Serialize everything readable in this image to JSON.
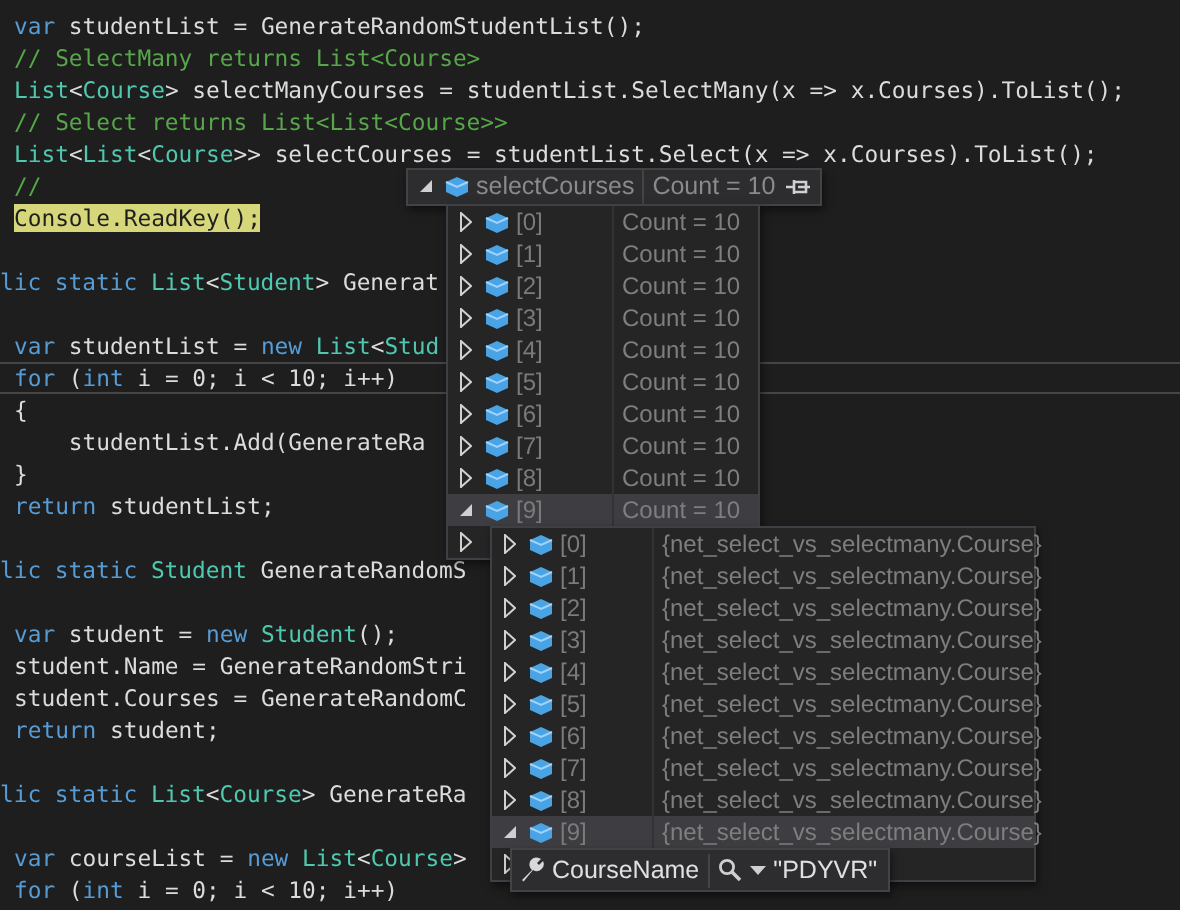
{
  "code": {
    "lines": [
      {
        "kind": "code",
        "current": false,
        "tokens": [
          {
            "text": "var",
            "kind": "keyword"
          },
          {
            "text": " studentList = GenerateRandomStudentList();",
            "kind": "plain"
          }
        ]
      },
      {
        "kind": "code",
        "current": false,
        "tokens": [
          {
            "text": "// SelectMany returns List<Course>",
            "kind": "comment"
          }
        ]
      },
      {
        "kind": "code",
        "current": false,
        "tokens": [
          {
            "text": "List",
            "kind": "type"
          },
          {
            "text": "<",
            "kind": "plain"
          },
          {
            "text": "Course",
            "kind": "type"
          },
          {
            "text": "> selectManyCourses = studentList.SelectMany(x => x.Courses).ToList();",
            "kind": "plain"
          }
        ]
      },
      {
        "kind": "code",
        "current": false,
        "tokens": [
          {
            "text": "// Select returns List<List<Course>>",
            "kind": "comment"
          }
        ]
      },
      {
        "kind": "code",
        "current": false,
        "tokens": [
          {
            "text": "List",
            "kind": "type"
          },
          {
            "text": "<",
            "kind": "plain"
          },
          {
            "text": "List",
            "kind": "type"
          },
          {
            "text": "<",
            "kind": "plain"
          },
          {
            "text": "Course",
            "kind": "type"
          },
          {
            "text": ">> selectCourses = studentList.Select(x => x.Courses).ToList();",
            "kind": "plain"
          }
        ]
      },
      {
        "kind": "code",
        "current": false,
        "tokens": [
          {
            "text": "//",
            "kind": "comment"
          }
        ]
      },
      {
        "kind": "code",
        "current": false,
        "tokens": [
          {
            "text": "Console.ReadKey();",
            "kind": "highlight"
          }
        ]
      },
      {
        "kind": "blank",
        "current": false
      },
      {
        "kind": "cut",
        "current": false,
        "tokens": [
          {
            "text": "lic static ",
            "kind": "keyword"
          },
          {
            "text": "List",
            "kind": "type"
          },
          {
            "text": "<",
            "kind": "plain"
          },
          {
            "text": "Student",
            "kind": "type"
          },
          {
            "text": "> Generat",
            "kind": "plain"
          }
        ]
      },
      {
        "kind": "blank",
        "current": false
      },
      {
        "kind": "code",
        "current": false,
        "tokens": [
          {
            "text": "var",
            "kind": "keyword"
          },
          {
            "text": " studentList = ",
            "kind": "plain"
          },
          {
            "text": "new ",
            "kind": "keyword"
          },
          {
            "text": "List",
            "kind": "type"
          },
          {
            "text": "<",
            "kind": "plain"
          },
          {
            "text": "Stud",
            "kind": "type"
          }
        ]
      },
      {
        "kind": "code",
        "current": true,
        "tokens": [
          {
            "text": "for",
            "kind": "keyword"
          },
          {
            "text": " (",
            "kind": "plain"
          },
          {
            "text": "int",
            "kind": "keyword"
          },
          {
            "text": " i = 0; i < 10; i++)",
            "kind": "plain"
          }
        ]
      },
      {
        "kind": "code",
        "current": false,
        "tokens": [
          {
            "text": "{",
            "kind": "plain"
          }
        ]
      },
      {
        "kind": "code",
        "current": false,
        "tokens": [
          {
            "text": "    studentList.Add(GenerateRa",
            "kind": "plain"
          }
        ]
      },
      {
        "kind": "code",
        "current": false,
        "tokens": [
          {
            "text": "}",
            "kind": "plain"
          }
        ]
      },
      {
        "kind": "code",
        "current": false,
        "tokens": [
          {
            "text": "return",
            "kind": "keyword"
          },
          {
            "text": " studentList;",
            "kind": "plain"
          }
        ]
      },
      {
        "kind": "blank",
        "current": false
      },
      {
        "kind": "cut",
        "current": false,
        "tokens": [
          {
            "text": "lic static ",
            "kind": "keyword"
          },
          {
            "text": "Student",
            "kind": "type"
          },
          {
            "text": " GenerateRandomS",
            "kind": "plain"
          }
        ]
      },
      {
        "kind": "blank",
        "current": false
      },
      {
        "kind": "code",
        "current": false,
        "tokens": [
          {
            "text": "var",
            "kind": "keyword"
          },
          {
            "text": " student = ",
            "kind": "plain"
          },
          {
            "text": "new ",
            "kind": "keyword"
          },
          {
            "text": "Student",
            "kind": "type"
          },
          {
            "text": "();",
            "kind": "plain"
          }
        ]
      },
      {
        "kind": "code",
        "current": false,
        "tokens": [
          {
            "text": "student.Name = GenerateRandomStri",
            "kind": "plain"
          }
        ]
      },
      {
        "kind": "code",
        "current": false,
        "tokens": [
          {
            "text": "student.Courses = GenerateRandomC",
            "kind": "plain"
          }
        ]
      },
      {
        "kind": "code",
        "current": false,
        "tokens": [
          {
            "text": "return",
            "kind": "keyword"
          },
          {
            "text": " student;",
            "kind": "plain"
          }
        ]
      },
      {
        "kind": "blank",
        "current": false
      },
      {
        "kind": "cut",
        "current": false,
        "tokens": [
          {
            "text": "lic static ",
            "kind": "keyword"
          },
          {
            "text": "List",
            "kind": "type"
          },
          {
            "text": "<",
            "kind": "plain"
          },
          {
            "text": "Course",
            "kind": "type"
          },
          {
            "text": "> GenerateRa",
            "kind": "plain"
          }
        ]
      },
      {
        "kind": "blank",
        "current": false
      },
      {
        "kind": "code",
        "current": false,
        "tokens": [
          {
            "text": "var",
            "kind": "keyword"
          },
          {
            "text": " courseList = ",
            "kind": "plain"
          },
          {
            "text": "new ",
            "kind": "keyword"
          },
          {
            "text": "List",
            "kind": "type"
          },
          {
            "text": "<",
            "kind": "plain"
          },
          {
            "text": "Course",
            "kind": "type"
          },
          {
            "text": ">",
            "kind": "plain"
          }
        ]
      },
      {
        "kind": "code",
        "current": false,
        "tokens": [
          {
            "text": "for",
            "kind": "keyword"
          },
          {
            "text": " (",
            "kind": "plain"
          },
          {
            "text": "int",
            "kind": "keyword"
          },
          {
            "text": " i = 0; i < 10; i++)",
            "kind": "plain"
          }
        ]
      }
    ]
  },
  "datatip": {
    "header": {
      "kind": "object",
      "name": "selectCourses",
      "value": "Count = 10",
      "expanded": true
    },
    "rows": [
      {
        "name": "[0]",
        "value": "Count = 10",
        "expanded": false,
        "selected": false
      },
      {
        "name": "[1]",
        "value": "Count = 10",
        "expanded": false,
        "selected": false
      },
      {
        "name": "[2]",
        "value": "Count = 10",
        "expanded": false,
        "selected": false
      },
      {
        "name": "[3]",
        "value": "Count = 10",
        "expanded": false,
        "selected": false
      },
      {
        "name": "[4]",
        "value": "Count = 10",
        "expanded": false,
        "selected": false
      },
      {
        "name": "[5]",
        "value": "Count = 10",
        "expanded": false,
        "selected": false
      },
      {
        "name": "[6]",
        "value": "Count = 10",
        "expanded": false,
        "selected": false
      },
      {
        "name": "[7]",
        "value": "Count = 10",
        "expanded": false,
        "selected": false
      },
      {
        "name": "[8]",
        "value": "Count = 10",
        "expanded": false,
        "selected": false
      },
      {
        "name": "[9]",
        "value": "Count = 10",
        "expanded": true,
        "selected": true,
        "children": {
          "rows": [
            {
              "name": "[0]",
              "value": "{net_select_vs_selectmany.Course}",
              "expanded": false,
              "selected": false
            },
            {
              "name": "[1]",
              "value": "{net_select_vs_selectmany.Course}",
              "expanded": false,
              "selected": false
            },
            {
              "name": "[2]",
              "value": "{net_select_vs_selectmany.Course}",
              "expanded": false,
              "selected": false
            },
            {
              "name": "[3]",
              "value": "{net_select_vs_selectmany.Course}",
              "expanded": false,
              "selected": false
            },
            {
              "name": "[4]",
              "value": "{net_select_vs_selectmany.Course}",
              "expanded": false,
              "selected": false
            },
            {
              "name": "[5]",
              "value": "{net_select_vs_selectmany.Course}",
              "expanded": false,
              "selected": false
            },
            {
              "name": "[6]",
              "value": "{net_select_vs_selectmany.Course}",
              "expanded": false,
              "selected": false
            },
            {
              "name": "[7]",
              "value": "{net_select_vs_selectmany.Course}",
              "expanded": false,
              "selected": false
            },
            {
              "name": "[8]",
              "value": "{net_select_vs_selectmany.Course}",
              "expanded": false,
              "selected": false
            },
            {
              "name": "[9]",
              "value": "{net_select_vs_selectmany.Course}",
              "expanded": true,
              "selected": true,
              "children": {
                "header": {
                  "kind": "property",
                  "name": "CourseName",
                  "value": "\"PDYVR\""
                }
              }
            }
          ]
        }
      }
    ]
  }
}
